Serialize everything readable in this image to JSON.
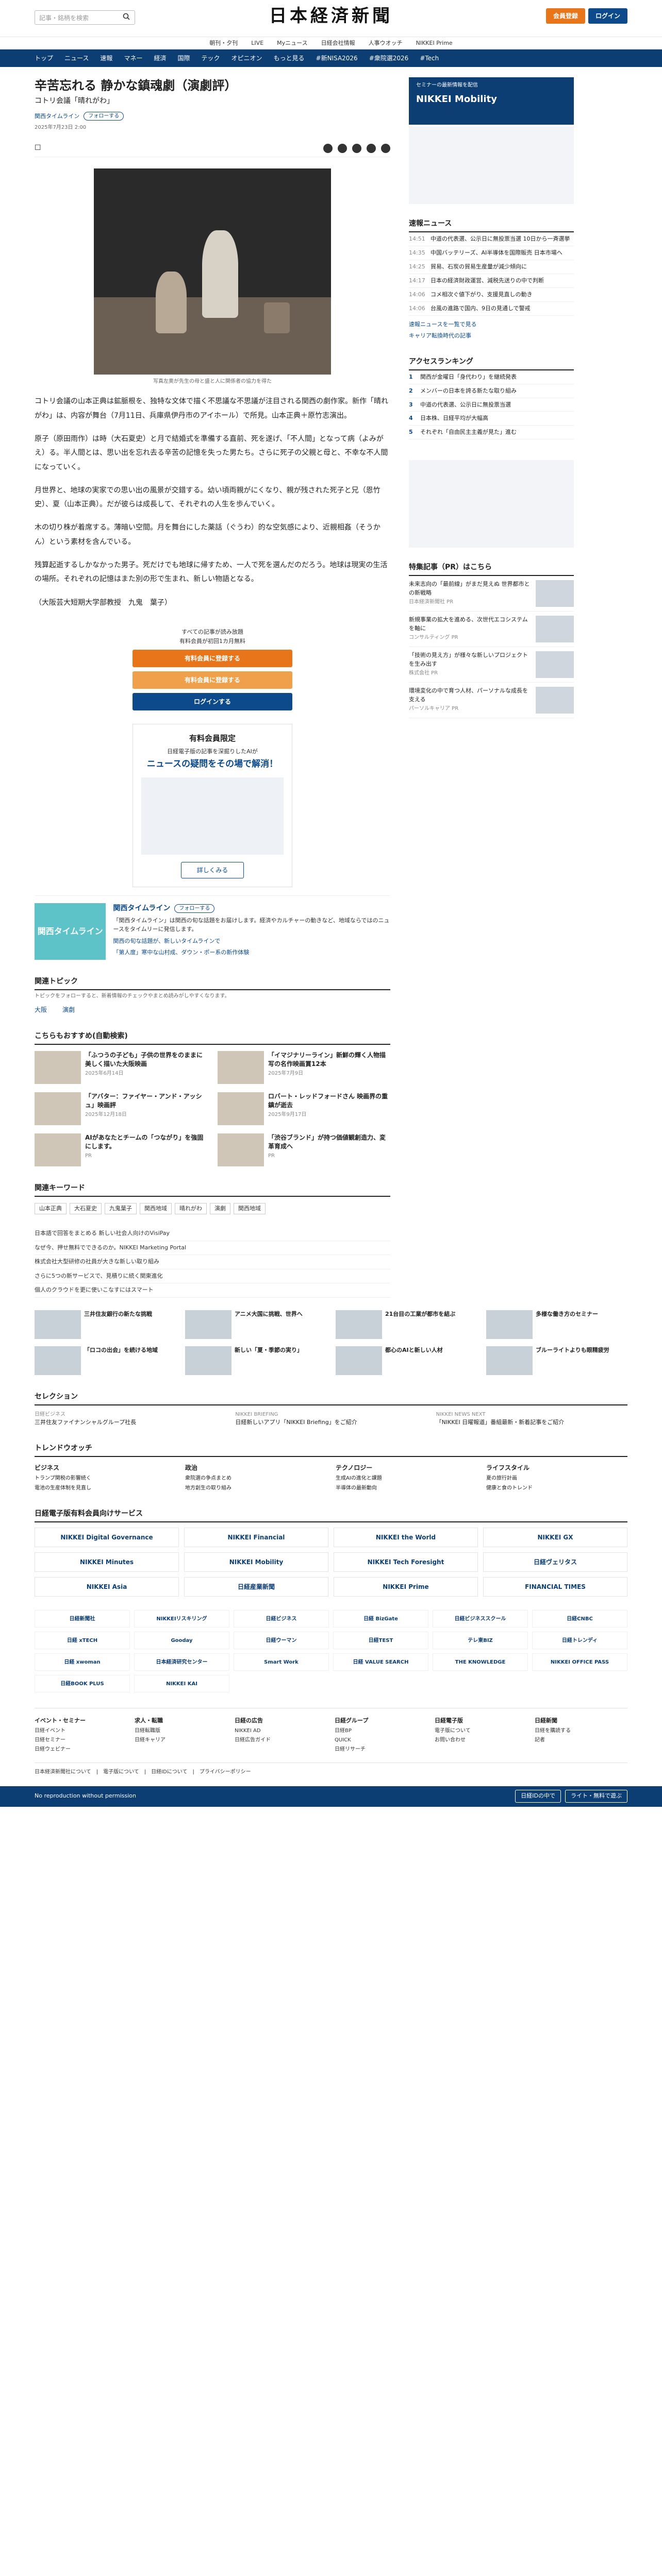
{
  "header": {
    "logo": "日本経済新聞",
    "search_placeholder": "記事・銘柄を検索",
    "signup": "会員登録",
    "login": "ログイン",
    "subnav": [
      "朝刊・夕刊",
      "LIVE",
      "Myニュース",
      "日経会社情報",
      "人事ウオッチ",
      "NIKKEI Prime"
    ],
    "mainnav": [
      "トップ",
      "ニュース",
      "速報",
      "マネー",
      "経済",
      "国際",
      "テック",
      "オピニオン",
      "もっと見る",
      "#新NISA2026",
      "#衆院選2026",
      "#Tech"
    ]
  },
  "article": {
    "title": "辛苦忘れる 静かな鎮魂劇（演劇評）",
    "subtitle": "コトリ会議「晴れがわ」",
    "author": "関西タイムライン",
    "follow": "フォローする",
    "date": "2025年7月23日 2:00",
    "caption": "写真左奥が先生の母と盛と人に関係者の協力を得た",
    "paragraphs": [
      "コトリ会議の山本正典は鉱脈根を、独特な文体で描く不思議な不思議が注目される関西の劇作家。新作「晴れがわ」は、内容が舞台（7月11日、兵庫県伊丹市のアイホール）で所見。山本正典＋原竹志演出。",
      "原子（原田雨作）は時（大石夏史）と月で結婚式を準備する直前、死を遂げ、「不人間」となって病（よみがえ）る。半人間とは、思い出を忘れ去る辛苦の記憶を失った男たち。さらに死子の父親と母と、不幸な不人間になっていく。",
      "月世界と、地球の実家での思い出の風景が交錯する。幼い頃両親がにくなり、親が残された死子と兄（恩竹史）、夏（山本正典）。だが彼らは成長して、それぞれの人生を歩んでいく。",
      "木の切り株が着席する。薄暗い空間。月を舞台にした薬話（ぐうわ）的な空気感により、近親相姦（そうかん）という素材を含んでいる。",
      "残算起逝するしかなかった男子。死だけでも地球に帰すため、一人で死を選んだのだろう。地球は現実の生活の場所。それぞれの記憶はまた別の形で生まれ、新しい物語となる。",
      "（大阪芸大短期大学部教授　九鬼　葉子）"
    ]
  },
  "paywall": {
    "line1": "すべての記事が読み放題",
    "line2": "有料会員が初回1カ月無料",
    "b1": "有料会員に登録する",
    "b2": "有料会員に登録する",
    "b3": "ログインする"
  },
  "yuryo": {
    "h": "有料会員限定",
    "s": "日経電子版の記事を深掘りしたAIが",
    "big": "ニュースの疑問をその場で解消！",
    "more": "詳しくみる"
  },
  "kansai": {
    "img": "関西タイムライン",
    "name": "関西タイムライン",
    "follow": "フォローする",
    "desc": "「関西タイムライン」は関西の旬な話題をお届けします。経済やカルチャーの動きなど、地域ならではのニュースをタイムリーに発信します。",
    "items": [
      "関西の旬な話題が、新しいタイムラインで",
      "「第人度」寒中な山村成、ダウン・ポー系の新作体験"
    ]
  },
  "topics": {
    "title": "関連トピック",
    "note": "トピックをフォローすると、新着情報のチェックやまとめ読みがしやすくなります。",
    "items": [
      "大阪",
      "演劇"
    ]
  },
  "recommend": {
    "title": "こちらもおすすめ(自動検索)",
    "items": [
      {
        "t": "「ふつうの子ども」子供の世界をのままに美しく描いた大阪映画",
        "d": "2025年6月14日"
      },
      {
        "t": "「イマジナリーライン」新鮮の輝く人物描写の名作映画賞12本",
        "d": "2025年7月9日"
      },
      {
        "t": "「アバター：ファイヤー・アンド・アッシュ」映画評",
        "d": "2025年12月18日"
      },
      {
        "t": "ロバート・レッドフォードさん 映画界の重鎮が逝去",
        "d": "2025年9月17日"
      },
      {
        "t": "AIがあなたとチームの「つながり」を強固にします。",
        "d": "PR"
      },
      {
        "t": "「渋谷ブランド」が持つ価値観創造力、変革育成へ",
        "d": "PR"
      }
    ]
  },
  "keywords": {
    "title": "関連キーワード",
    "items": [
      "山本正典",
      "大石夏史",
      "九鬼葉子",
      "関西地域",
      "晴れがわ",
      "演劇",
      "関西地域"
    ]
  },
  "pr": {
    "items": [
      "日本語で回答をまとめる 新しい社会人向けのVisiPay",
      "なぜ今、押せ無料でできるのか。NIKKEI Marketing Portal",
      "株式会社大型研修の社員が大きな新しい取り組み",
      "さらに5つの新サービスで、見積りに続く関東進化",
      "個人のクラウドを更に使いこなすにはスマート"
    ]
  },
  "sidebar": {
    "ad1": "セミナーの最新情報を配信",
    "ad2": "NIKKEI Mobility",
    "breaking_title": "速報ニュース",
    "breaking": [
      {
        "tm": "14:51",
        "t": "中道の代表選、公示日に無投票当選 10日から一斉選挙"
      },
      {
        "tm": "14:35",
        "t": "中国バッテリーズ、AI半導体を国際販売 日本市場へ"
      },
      {
        "tm": "14:25",
        "t": "貿易、石炭の貿易生産量が減少傾向に"
      },
      {
        "tm": "14:17",
        "t": "日本の経済財政運営、減税先送りの中で判断"
      },
      {
        "tm": "14:06",
        "t": "コメ相次ぐ値下がり、支援見直しの動き"
      },
      {
        "tm": "14:06",
        "t": "台風の進路で国内、9日の見通しで警戒"
      }
    ],
    "breaking_links": [
      "速報ニュースを一覧で見る",
      "キャリア転換時代の記事"
    ],
    "ranking_title": "アクセスランキング",
    "ranking": [
      "関西が金曜日「身代わり」を継続発表",
      "メンバーの日本を誇る新たな取り組み",
      "中道の代表選、公示日に無投票当選",
      "日本株、日経平均が大幅高",
      "それぞれ「自由民主主義が見た」進む"
    ],
    "special_title": "特集記事（PR）はこちら",
    "special": [
      {
        "t": "未来志向の「最前線」がまだ見えぬ 世界都市との新戦略",
        "tag": "日本経済新聞社 PR"
      },
      {
        "t": "新規事業の拡大を進める、次世代エコシステムを軸に",
        "tag": "コンサルティング PR"
      },
      {
        "t": "「技術の見え方」が様々な新しいプロジェクトを生み出す",
        "tag": "株式会社 PR"
      },
      {
        "t": "環境変化の中で育つ人材、パーソナルな成長を支える",
        "tag": "パーソルキャリア PR"
      }
    ]
  },
  "lower": {
    "grid4": [
      "三井住友銀行の新たな挑戦",
      "アニメ大国に挑戦、世界へ",
      "21台目の工業が都市を結ぶ",
      "多様な働き方のセミナー",
      "「ロコの出会」を続ける地域",
      "新しい「夏・季節の実り」",
      "都心のAIと新しい人材",
      "ブルーライトよりも眼精疲労"
    ],
    "selection_title": "セレクション",
    "selection": [
      {
        "lbl": "日経ビジネス",
        "t": "三井住友ファイナンシャルグループ社長"
      },
      {
        "lbl": "NIKKEI BRIEFING",
        "t": "日経新しいアプリ「NIKKEI Briefing」をご紹介"
      },
      {
        "lbl": "NIKKEI NEWS NEXT",
        "t": "「NIKKEI 日曜報道」番組最新・新着記事をご紹介"
      }
    ],
    "trend_title": "トレンドウオッチ",
    "trend": [
      {
        "h": "ビジネス",
        "items": [
          "トランプ関税の影響続く",
          "電池の生産体制を見直し"
        ]
      },
      {
        "h": "政治",
        "items": [
          "衆院選の争点まとめ",
          "地方創生の取り組み"
        ]
      },
      {
        "h": "テクノロジー",
        "items": [
          "生成AIの進化と課題",
          "半導体の最新動向"
        ]
      },
      {
        "h": "ライフスタイル",
        "items": [
          "夏の旅行計画",
          "健康と食のトレンド"
        ]
      }
    ],
    "brands_title": "日経電子版有料会員向けサービス",
    "brands": [
      "NIKKEI Digital Governance",
      "NIKKEI Financial",
      "NIKKEI the World",
      "NIKKEI GX",
      "NIKKEI Minutes",
      "NIKKEI Mobility",
      "NIKKEI Tech Foresight",
      "日経ヴェリタス",
      "NIKKEI Asia",
      "日経産業新聞",
      "NIKKEI Prime",
      "FINANCIAL TIMES"
    ],
    "brands6": [
      "日経新聞社",
      "NIKKEIリスキリング",
      "日経ビジネス",
      "日経 BizGate",
      "日経ビジネススクール",
      "日経CNBC",
      "日経 xTECH",
      "Gooday",
      "日経ウーマン",
      "日経TEST",
      "テレ東BIZ",
      "日経トレンディ",
      "日経 xwoman",
      "日本経済研究センター",
      "Smart Work",
      "日経 VALUE SEARCH",
      "THE KNOWLEDGE",
      "NIKKEI OFFICE PASS",
      "日経BOOK PLUS",
      "NIKKEI KAI"
    ],
    "foot_cols": [
      {
        "h": "イベント・セミナー",
        "items": [
          "日経イベント",
          "日経セミナー",
          "日経ウェビナー"
        ]
      },
      {
        "h": "求人・転職",
        "items": [
          "日経転職版",
          "日経キャリア"
        ]
      },
      {
        "h": "日経の広告",
        "items": [
          "NIKKEI AD",
          "日経広告ガイド"
        ]
      },
      {
        "h": "日経グループ",
        "items": [
          "日経BP",
          "QUICK",
          "日経リサーチ"
        ]
      },
      {
        "h": "日経電子版",
        "items": [
          "電子版について",
          "お問い合わせ"
        ]
      },
      {
        "h": "日経新聞",
        "items": [
          "日経を購読する",
          "記者"
        ]
      }
    ],
    "bottom": "日本経済新聞社について　|　電子版について　|　日経IDについて　|　プライバシーポリシー",
    "copyright": "No reproduction without permission",
    "bar_btn1": "日経IDの中で",
    "bar_btn2": "ライト・無料で遊ぶ"
  }
}
